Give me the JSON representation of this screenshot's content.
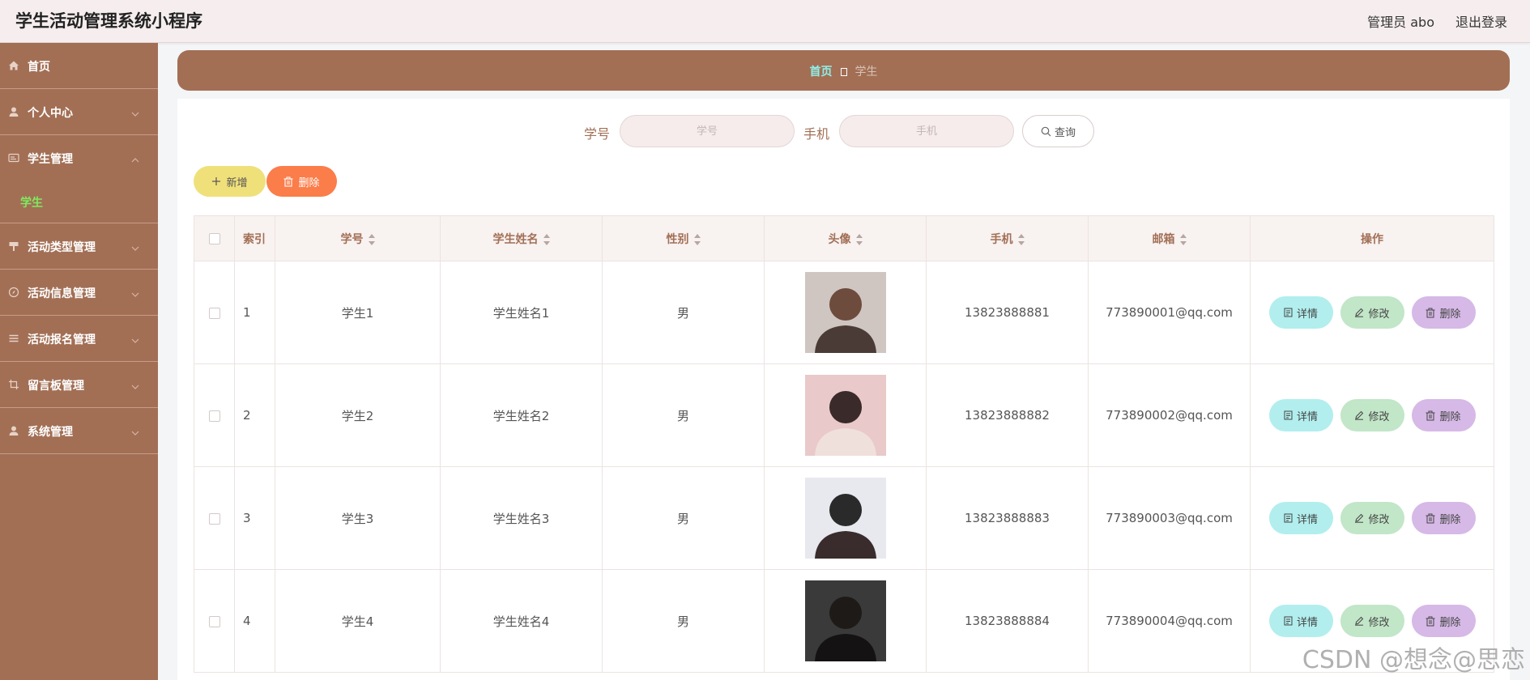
{
  "header": {
    "title": "学生活动管理系统小程序",
    "admin_label": "管理员 abo",
    "logout": "退出登录"
  },
  "sidebar": {
    "items": [
      {
        "label": "首页",
        "icon": "home-icon"
      },
      {
        "label": "个人中心",
        "icon": "user-icon"
      },
      {
        "label": "学生管理",
        "icon": "id-card-icon",
        "expanded": true,
        "children": [
          {
            "label": "学生"
          }
        ]
      },
      {
        "label": "活动类型管理",
        "icon": "signpost-icon"
      },
      {
        "label": "活动信息管理",
        "icon": "compass-icon"
      },
      {
        "label": "活动报名管理",
        "icon": "list-icon"
      },
      {
        "label": "留言板管理",
        "icon": "crop-icon"
      },
      {
        "label": "系统管理",
        "icon": "user-icon"
      }
    ]
  },
  "breadcrumb": {
    "home": "首页",
    "current": "学生"
  },
  "search": {
    "student_no_label": "学号",
    "student_no_placeholder": "学号",
    "phone_label": "手机",
    "phone_placeholder": "手机",
    "query_button": "查询"
  },
  "toolbar": {
    "add_button": "新增",
    "delete_button": "删除"
  },
  "table": {
    "columns": [
      "索引",
      "学号",
      "学生姓名",
      "性别",
      "头像",
      "手机",
      "邮箱",
      "操作"
    ],
    "rows": [
      {
        "index": "1",
        "student_no": "学生1",
        "name": "学生姓名1",
        "gender": "男",
        "phone": "13823888881",
        "email": "773890001@qq.com"
      },
      {
        "index": "2",
        "student_no": "学生2",
        "name": "学生姓名2",
        "gender": "男",
        "phone": "13823888882",
        "email": "773890002@qq.com"
      },
      {
        "index": "3",
        "student_no": "学生3",
        "name": "学生姓名3",
        "gender": "男",
        "phone": "13823888883",
        "email": "773890003@qq.com"
      },
      {
        "index": "4",
        "student_no": "学生4",
        "name": "学生姓名4",
        "gender": "男",
        "phone": "13823888884",
        "email": "773890004@qq.com"
      }
    ],
    "actions": {
      "detail": "详情",
      "edit": "修改",
      "delete": "删除"
    }
  },
  "watermark": "CSDN @想念@思恋",
  "colors": {
    "accent": "#a26f55",
    "header_bg": "#f6eeee",
    "active_submenu": "#7eea5e",
    "add_button": "#f0e07a",
    "delete_button": "#fb7d4a",
    "detail_button": "#b2eeee",
    "edit_button": "#c2e6c8",
    "row_delete_button": "#d6b9e6"
  }
}
